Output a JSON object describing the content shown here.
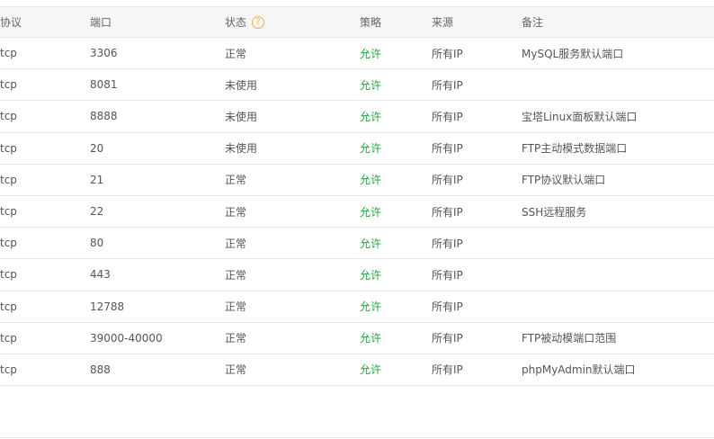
{
  "table": {
    "headers": {
      "protocol": "协议",
      "port": "端口",
      "status": "状态",
      "status_help": "?",
      "policy": "策略",
      "source": "来源",
      "remark": "备注"
    },
    "rows": [
      {
        "protocol": "tcp",
        "port": "3306",
        "status": "正常",
        "policy": "允许",
        "source": "所有IP",
        "remark": "MySQL服务默认端口"
      },
      {
        "protocol": "tcp",
        "port": "8081",
        "status": "未使用",
        "policy": "允许",
        "source": "所有IP",
        "remark": ""
      },
      {
        "protocol": "tcp",
        "port": "8888",
        "status": "未使用",
        "policy": "允许",
        "source": "所有IP",
        "remark": "宝塔Linux面板默认端口"
      },
      {
        "protocol": "tcp",
        "port": "20",
        "status": "未使用",
        "policy": "允许",
        "source": "所有IP",
        "remark": "FTP主动模式数据端口"
      },
      {
        "protocol": "tcp",
        "port": "21",
        "status": "正常",
        "policy": "允许",
        "source": "所有IP",
        "remark": "FTP协议默认端口"
      },
      {
        "protocol": "tcp",
        "port": "22",
        "status": "正常",
        "policy": "允许",
        "source": "所有IP",
        "remark": "SSH远程服务"
      },
      {
        "protocol": "tcp",
        "port": "80",
        "status": "正常",
        "policy": "允许",
        "source": "所有IP",
        "remark": ""
      },
      {
        "protocol": "tcp",
        "port": "443",
        "status": "正常",
        "policy": "允许",
        "source": "所有IP",
        "remark": ""
      },
      {
        "protocol": "tcp",
        "port": "12788",
        "status": "正常",
        "policy": "允许",
        "source": "所有IP",
        "remark": ""
      },
      {
        "protocol": "tcp",
        "port": "39000-40000",
        "status": "正常",
        "policy": "允许",
        "source": "所有IP",
        "remark": "FTP被动模端口范围"
      },
      {
        "protocol": "tcp",
        "port": "888",
        "status": "正常",
        "policy": "允许",
        "source": "所有IP",
        "remark": "phpMyAdmin默认端口"
      }
    ]
  },
  "colors": {
    "allow": "#20a53a",
    "help_icon": "#f0ad4e",
    "header_bg": "#f6f6f6",
    "border": "#e6e6e6"
  },
  "icons": {
    "status_help": "question-circle-icon"
  }
}
